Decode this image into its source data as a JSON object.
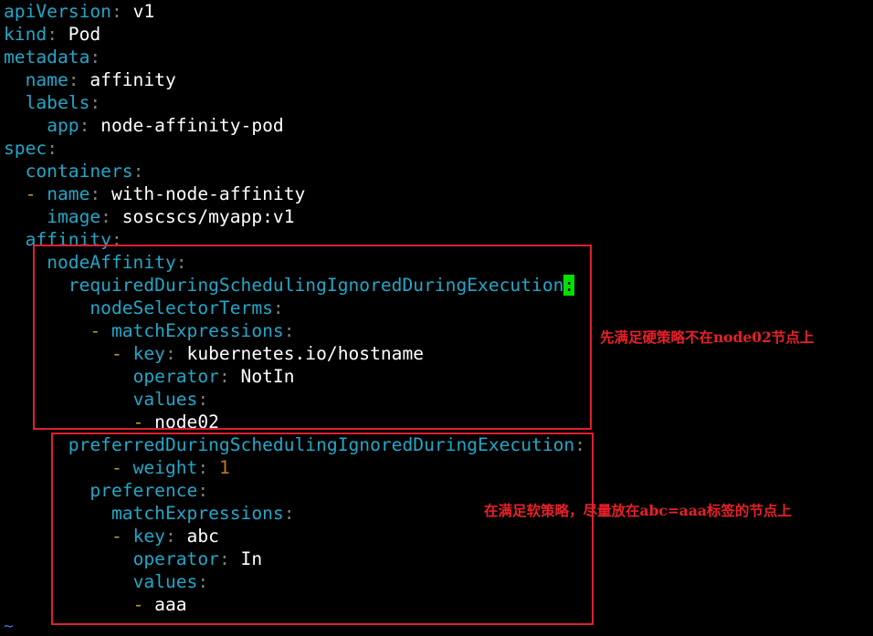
{
  "editor": {
    "lines": [
      {
        "indent": "",
        "key": "apiVersion",
        "value": "v1"
      },
      {
        "indent": "",
        "key": "kind",
        "value": "Pod"
      },
      {
        "indent": "",
        "key": "metadata",
        "value": ""
      },
      {
        "indent": "  ",
        "key": "name",
        "value": "affinity"
      },
      {
        "indent": "  ",
        "key": "labels",
        "value": ""
      },
      {
        "indent": "    ",
        "key": "app",
        "value": "node-affinity-pod"
      },
      {
        "indent": "",
        "key": "spec",
        "value": ""
      },
      {
        "indent": "  ",
        "key": "containers",
        "value": ""
      },
      {
        "indent": "  ",
        "dash": true,
        "key": "name",
        "value": "with-node-affinity"
      },
      {
        "indent": "    ",
        "key": "image",
        "value": "soscscs/myapp:v1"
      },
      {
        "indent": "  ",
        "key": "affinity",
        "value": ""
      },
      {
        "indent": "    ",
        "key": "nodeAffinity",
        "value": ""
      },
      {
        "indent": "      ",
        "key": "requiredDuringSchedulingIgnoredDuringExecution",
        "value": "",
        "cursor": true
      },
      {
        "indent": "        ",
        "key": "nodeSelectorTerms",
        "value": ""
      },
      {
        "indent": "        ",
        "dash": true,
        "key": "matchExpressions",
        "value": ""
      },
      {
        "indent": "          ",
        "dash": true,
        "key": "key",
        "value": "kubernetes.io/hostname"
      },
      {
        "indent": "            ",
        "key": "operator",
        "value": "NotIn"
      },
      {
        "indent": "            ",
        "key": "values",
        "value": ""
      },
      {
        "indent": "            ",
        "dash": true,
        "plain": "node02"
      },
      {
        "indent": "      ",
        "key": "preferredDuringSchedulingIgnoredDuringExecution",
        "value": ""
      },
      {
        "indent": "          ",
        "dash": true,
        "key": "weight",
        "value": "1",
        "numeric": true
      },
      {
        "indent": "        ",
        "key": "preference",
        "value": ""
      },
      {
        "indent": "          ",
        "key": "matchExpressions",
        "value": ""
      },
      {
        "indent": "          ",
        "dash": true,
        "key": "key",
        "value": "abc"
      },
      {
        "indent": "            ",
        "key": "operator",
        "value": "In"
      },
      {
        "indent": "            ",
        "key": "values",
        "value": ""
      },
      {
        "indent": "            ",
        "dash": true,
        "plain": "aaa"
      }
    ],
    "tilde": "~"
  },
  "annotations": {
    "required_note": "先满足硬策略不在node02节点上",
    "preferred_note": "在满足软策略，尽量放在abc=aaa标签的节点上",
    "box_color": "#e0202c"
  },
  "colors": {
    "background": "#000000",
    "key": "#22a7c8",
    "value": "#ffffff",
    "dash": "#c0a020",
    "number": "#c07a20",
    "cursor": "#00e000"
  }
}
